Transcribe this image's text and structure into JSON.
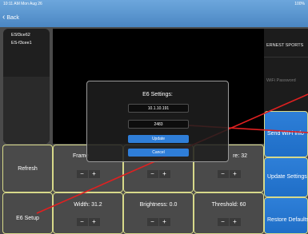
{
  "status_bar": {
    "time": "10:11 AM  Mon Aug 26",
    "battery": "100%"
  },
  "nav": {
    "back_label": "Back"
  },
  "devices": [
    "ESf3ce62",
    "ES-f3cee1"
  ],
  "wifi": {
    "ssid": "ERNEST SPORTS",
    "password_placeholder": "WiFi Password"
  },
  "controls": {
    "refresh": "Refresh",
    "e6_setup": "E6 Setup",
    "framerate_label": "Frame",
    "exposure_label": "re: 32",
    "width_label": "Width: 31.2",
    "brightness_label": "Brightness: 0.0",
    "threshold_label": "Threshold: 60",
    "minus": "−",
    "plus": "+"
  },
  "right_buttons": {
    "send_wifi": "Send WiFi Info",
    "update_settings": "Update Settings",
    "restore_defaults": "Restore Defaults"
  },
  "dialog": {
    "title": "E6 Settings:",
    "ip_value": "10.1.10.191",
    "port_value": "2483",
    "update_label": "Update",
    "cancel_label": "Cancel"
  },
  "colors": {
    "accent_blue": "#2e7fd8",
    "tile_border": "#d7d98a",
    "laser_red": "#e02020"
  }
}
